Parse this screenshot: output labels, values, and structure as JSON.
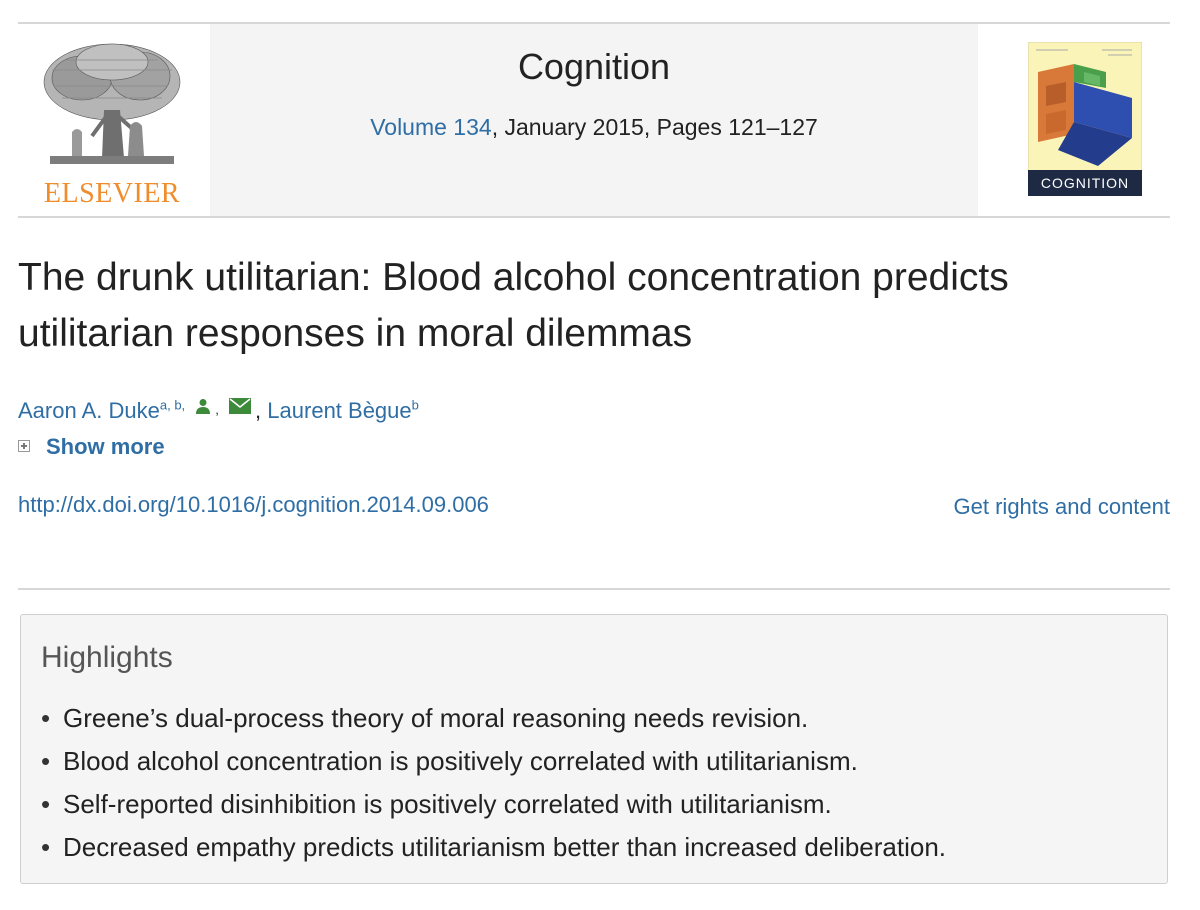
{
  "header": {
    "journal_title": "Cognition",
    "volume_link": "Volume 134",
    "volume_rest": ", January 2015, Pages 121–127",
    "publisher_logo_text": "ELSEVIER",
    "cover_label": "COGNITION"
  },
  "article": {
    "title": "The drunk utilitarian: Blood alcohol concentration predicts utilitarian responses in moral dilemmas",
    "authors": [
      {
        "name": "Aaron A. Duke",
        "affiliations": "a, b,"
      },
      {
        "name": "Laurent Bègue",
        "affiliations": "b"
      }
    ],
    "author_separator": ",",
    "show_more": "Show more",
    "doi": "http://dx.doi.org/10.1016/j.cognition.2014.09.006",
    "rights_link": "Get rights and content"
  },
  "highlights": {
    "heading": "Highlights",
    "items": [
      "Greene’s dual-process theory of moral reasoning needs revision.",
      "Blood alcohol concentration is positively correlated with utilitarianism.",
      "Self-reported disinhibition is positively correlated with utilitarianism.",
      "Decreased empathy predicts utilitarianism better than increased deliberation."
    ]
  },
  "icons": {
    "author_icon": "person-icon",
    "email_icon": "envelope-icon",
    "expand_icon": "plus-box-icon"
  },
  "colors": {
    "link": "#2f6ea5",
    "publisher_orange": "#f08c2a",
    "icon_green": "#3c8a3a"
  }
}
